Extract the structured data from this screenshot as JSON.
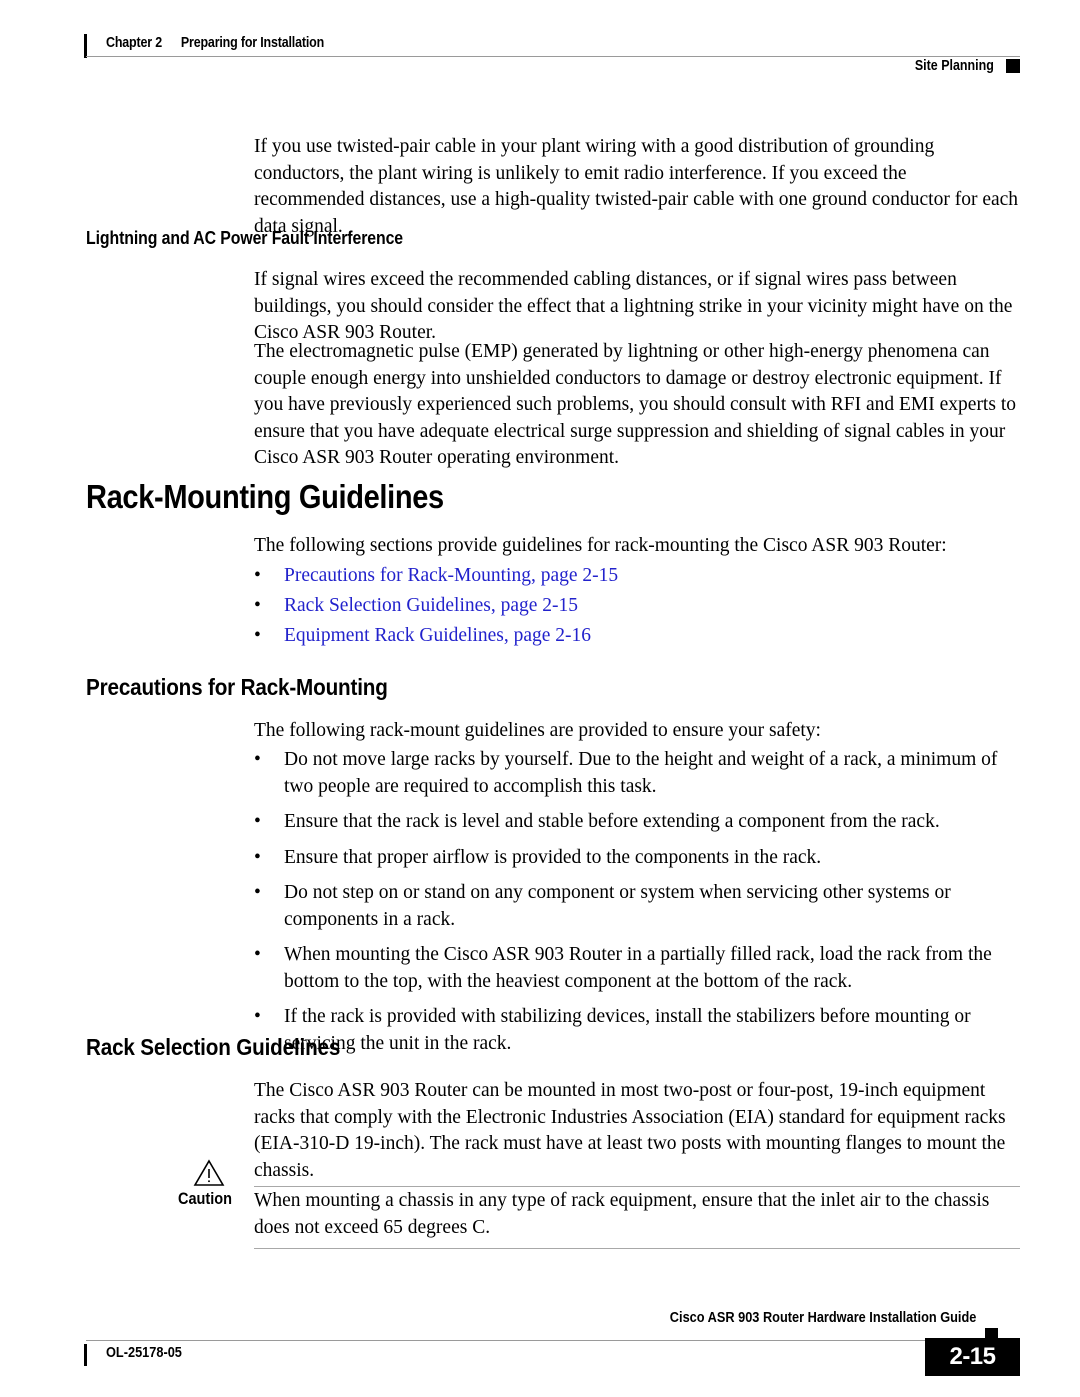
{
  "header": {
    "chapter_number": "Chapter 2",
    "chapter_title": "Preparing for Installation",
    "section": "Site Planning"
  },
  "body": {
    "intro_paragraph": "If you use twisted-pair cable in your plant wiring with a good distribution of grounding conductors, the plant wiring is unlikely to emit radio interference. If you exceed the recommended distances, use a high-quality twisted-pair cable with one ground conductor for each data signal.",
    "lightning_heading": "Lightning and AC Power Fault Interference",
    "lightning_para_1": "If signal wires exceed the recommended cabling distances, or if signal wires pass between buildings, you should consider the effect that a lightning strike in your vicinity might have on the Cisco ASR 903 Router.",
    "lightning_para_2": "The electromagnetic pulse (EMP) generated by lightning or other high-energy phenomena can couple enough energy into unshielded conductors to damage or destroy electronic equipment. If you have previously experienced such problems, you should consult with RFI and EMI experts to ensure that you have adequate electrical surge suppression and shielding of signal cables in your Cisco ASR 903 Router operating environment.",
    "rack_mounting_heading": "Rack-Mounting Guidelines",
    "rack_mounting_intro": "The following sections provide guidelines for rack-mounting the Cisco ASR 903 Router:",
    "rack_mounting_links": [
      "Precautions for Rack-Mounting, page 2-15",
      "Rack Selection Guidelines, page 2-15",
      "Equipment Rack Guidelines, page 2-16"
    ],
    "precautions_heading": "Precautions for Rack-Mounting",
    "precautions_intro": "The following rack-mount guidelines are provided to ensure your safety:",
    "precautions_bullets": [
      "Do not move large racks by yourself. Due to the height and weight of a rack, a minimum of two people are required to accomplish this task.",
      "Ensure that the rack is level and stable before extending a component from the rack.",
      "Ensure that proper airflow is provided to the components in the rack.",
      "Do not step on or stand on any component or system when servicing other systems or components in a rack.",
      "When mounting the Cisco ASR 903 Router in a partially filled rack, load the rack from the bottom to the top, with the heaviest component at the bottom of the rack.",
      "If the rack is provided with stabilizing devices, install the stabilizers before mounting or servicing the unit in the rack."
    ],
    "rack_selection_heading": "Rack Selection Guidelines",
    "rack_selection_para": "The Cisco ASR 903 Router can be mounted in most two-post or four-post, 19-inch equipment racks that comply with the Electronic Industries Association (EIA) standard for equipment racks (EIA-310-D 19-inch). The rack must have at least two posts with mounting flanges to mount the chassis.",
    "caution_label": "Caution",
    "caution_text": "When mounting a chassis in any type of rack equipment, ensure that the inlet air to the chassis does not exceed 65 degrees C."
  },
  "footer": {
    "guide_title": "Cisco ASR 903 Router Hardware Installation Guide",
    "doc_id": "OL-25178-05",
    "page_number": "2-15"
  },
  "colors": {
    "link": "#2222cc",
    "rule": "#9a9a9a",
    "text": "#000000"
  },
  "bullet_glyph": "•"
}
